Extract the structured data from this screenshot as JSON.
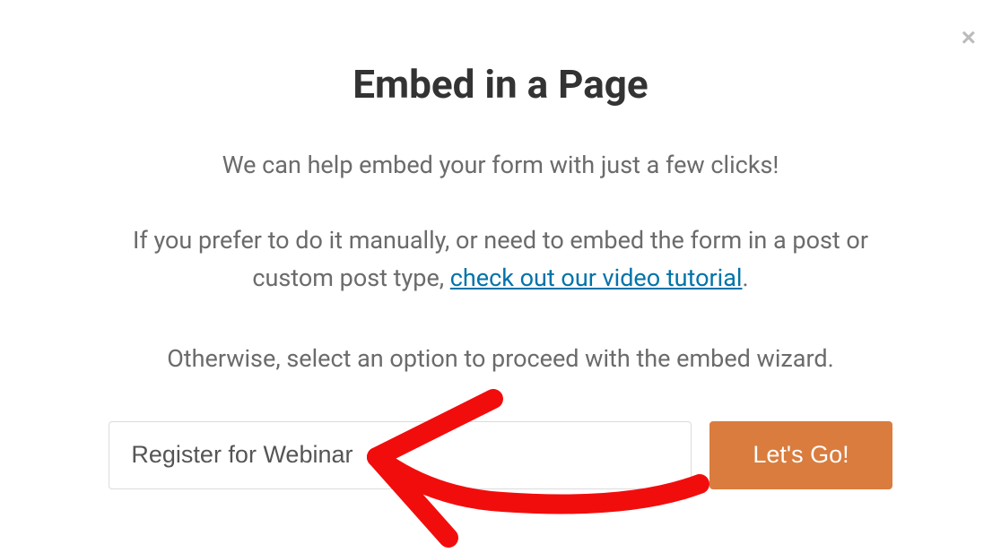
{
  "modal": {
    "title": "Embed in a Page",
    "subtitle": "We can help embed your form with just a few clicks!",
    "para1_prefix": "If you prefer to do it manually, or need to embed the form in a post or custom post type, ",
    "para1_link": "check out our video tutorial",
    "para1_suffix": ".",
    "para2": "Otherwise, select an option to proceed with the embed wizard.",
    "input_value": "Register for Webinar",
    "go_label": "Let's Go!",
    "close_label": "×"
  }
}
